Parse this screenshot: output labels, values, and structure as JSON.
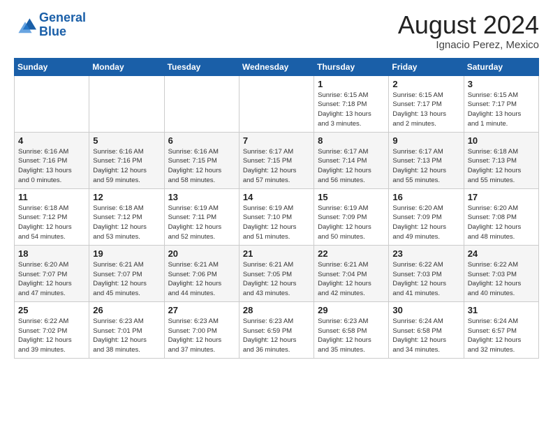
{
  "header": {
    "logo_line1": "General",
    "logo_line2": "Blue",
    "month_title": "August 2024",
    "subtitle": "Ignacio Perez, Mexico"
  },
  "weekdays": [
    "Sunday",
    "Monday",
    "Tuesday",
    "Wednesday",
    "Thursday",
    "Friday",
    "Saturday"
  ],
  "weeks": [
    [
      {
        "day": "",
        "info": ""
      },
      {
        "day": "",
        "info": ""
      },
      {
        "day": "",
        "info": ""
      },
      {
        "day": "",
        "info": ""
      },
      {
        "day": "1",
        "info": "Sunrise: 6:15 AM\nSunset: 7:18 PM\nDaylight: 13 hours\nand 3 minutes."
      },
      {
        "day": "2",
        "info": "Sunrise: 6:15 AM\nSunset: 7:17 PM\nDaylight: 13 hours\nand 2 minutes."
      },
      {
        "day": "3",
        "info": "Sunrise: 6:15 AM\nSunset: 7:17 PM\nDaylight: 13 hours\nand 1 minute."
      }
    ],
    [
      {
        "day": "4",
        "info": "Sunrise: 6:16 AM\nSunset: 7:16 PM\nDaylight: 13 hours\nand 0 minutes."
      },
      {
        "day": "5",
        "info": "Sunrise: 6:16 AM\nSunset: 7:16 PM\nDaylight: 12 hours\nand 59 minutes."
      },
      {
        "day": "6",
        "info": "Sunrise: 6:16 AM\nSunset: 7:15 PM\nDaylight: 12 hours\nand 58 minutes."
      },
      {
        "day": "7",
        "info": "Sunrise: 6:17 AM\nSunset: 7:15 PM\nDaylight: 12 hours\nand 57 minutes."
      },
      {
        "day": "8",
        "info": "Sunrise: 6:17 AM\nSunset: 7:14 PM\nDaylight: 12 hours\nand 56 minutes."
      },
      {
        "day": "9",
        "info": "Sunrise: 6:17 AM\nSunset: 7:13 PM\nDaylight: 12 hours\nand 55 minutes."
      },
      {
        "day": "10",
        "info": "Sunrise: 6:18 AM\nSunset: 7:13 PM\nDaylight: 12 hours\nand 55 minutes."
      }
    ],
    [
      {
        "day": "11",
        "info": "Sunrise: 6:18 AM\nSunset: 7:12 PM\nDaylight: 12 hours\nand 54 minutes."
      },
      {
        "day": "12",
        "info": "Sunrise: 6:18 AM\nSunset: 7:12 PM\nDaylight: 12 hours\nand 53 minutes."
      },
      {
        "day": "13",
        "info": "Sunrise: 6:19 AM\nSunset: 7:11 PM\nDaylight: 12 hours\nand 52 minutes."
      },
      {
        "day": "14",
        "info": "Sunrise: 6:19 AM\nSunset: 7:10 PM\nDaylight: 12 hours\nand 51 minutes."
      },
      {
        "day": "15",
        "info": "Sunrise: 6:19 AM\nSunset: 7:09 PM\nDaylight: 12 hours\nand 50 minutes."
      },
      {
        "day": "16",
        "info": "Sunrise: 6:20 AM\nSunset: 7:09 PM\nDaylight: 12 hours\nand 49 minutes."
      },
      {
        "day": "17",
        "info": "Sunrise: 6:20 AM\nSunset: 7:08 PM\nDaylight: 12 hours\nand 48 minutes."
      }
    ],
    [
      {
        "day": "18",
        "info": "Sunrise: 6:20 AM\nSunset: 7:07 PM\nDaylight: 12 hours\nand 47 minutes."
      },
      {
        "day": "19",
        "info": "Sunrise: 6:21 AM\nSunset: 7:07 PM\nDaylight: 12 hours\nand 45 minutes."
      },
      {
        "day": "20",
        "info": "Sunrise: 6:21 AM\nSunset: 7:06 PM\nDaylight: 12 hours\nand 44 minutes."
      },
      {
        "day": "21",
        "info": "Sunrise: 6:21 AM\nSunset: 7:05 PM\nDaylight: 12 hours\nand 43 minutes."
      },
      {
        "day": "22",
        "info": "Sunrise: 6:21 AM\nSunset: 7:04 PM\nDaylight: 12 hours\nand 42 minutes."
      },
      {
        "day": "23",
        "info": "Sunrise: 6:22 AM\nSunset: 7:03 PM\nDaylight: 12 hours\nand 41 minutes."
      },
      {
        "day": "24",
        "info": "Sunrise: 6:22 AM\nSunset: 7:03 PM\nDaylight: 12 hours\nand 40 minutes."
      }
    ],
    [
      {
        "day": "25",
        "info": "Sunrise: 6:22 AM\nSunset: 7:02 PM\nDaylight: 12 hours\nand 39 minutes."
      },
      {
        "day": "26",
        "info": "Sunrise: 6:23 AM\nSunset: 7:01 PM\nDaylight: 12 hours\nand 38 minutes."
      },
      {
        "day": "27",
        "info": "Sunrise: 6:23 AM\nSunset: 7:00 PM\nDaylight: 12 hours\nand 37 minutes."
      },
      {
        "day": "28",
        "info": "Sunrise: 6:23 AM\nSunset: 6:59 PM\nDaylight: 12 hours\nand 36 minutes."
      },
      {
        "day": "29",
        "info": "Sunrise: 6:23 AM\nSunset: 6:58 PM\nDaylight: 12 hours\nand 35 minutes."
      },
      {
        "day": "30",
        "info": "Sunrise: 6:24 AM\nSunset: 6:58 PM\nDaylight: 12 hours\nand 34 minutes."
      },
      {
        "day": "31",
        "info": "Sunrise: 6:24 AM\nSunset: 6:57 PM\nDaylight: 12 hours\nand 32 minutes."
      }
    ]
  ]
}
